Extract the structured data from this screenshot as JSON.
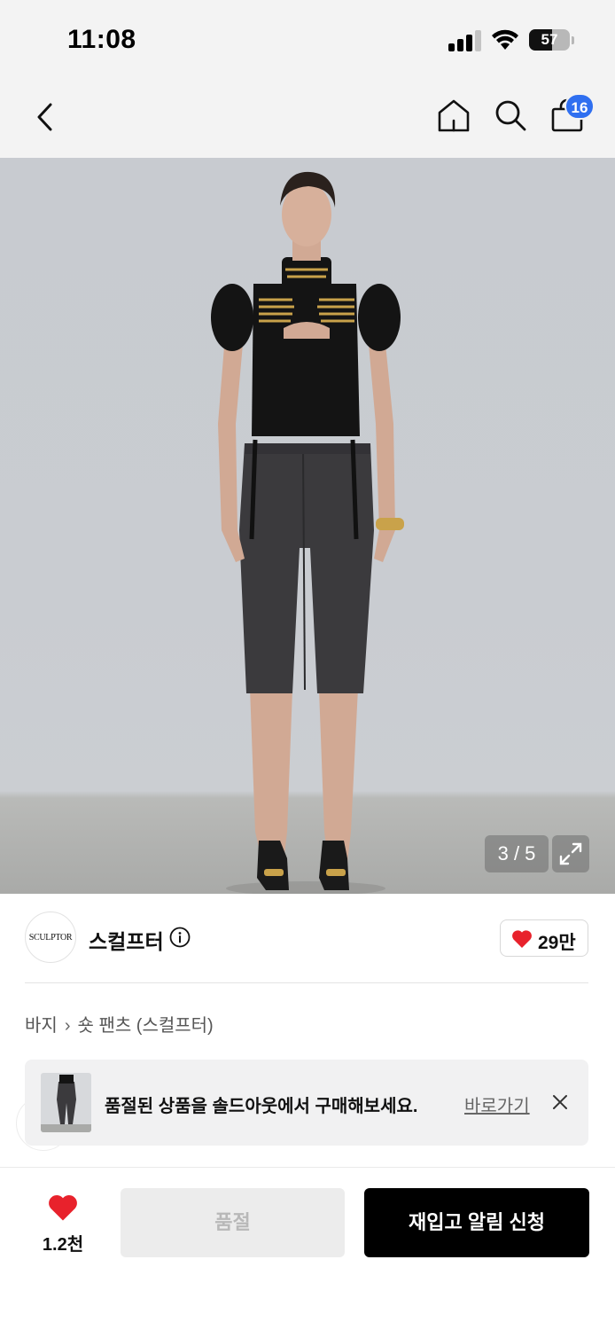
{
  "status_bar": {
    "time": "11:08",
    "battery_level": "57",
    "battery_fraction": 0.57,
    "signal_bars": 3
  },
  "nav": {
    "back_icon": "chevron-left-icon",
    "home_icon": "home-icon",
    "search_icon": "search-icon",
    "cart_icon": "shopping-bag-icon",
    "cart_count": "16",
    "badge_color": "#2f6ff0"
  },
  "product_image": {
    "counter": "3 / 5",
    "expand_icon": "expand-icon"
  },
  "brand": {
    "logo_text": "SCULPTOR",
    "name": "스컬프터",
    "info_icon": "info-icon",
    "likes": "29만",
    "heart_color": "#e8222c"
  },
  "breadcrumb": {
    "category": "바지",
    "subcategory": "숏 팬츠 (스컬프터)"
  },
  "toast": {
    "message": "품절된 상품을 솔드아웃에서 구매해보세요.",
    "link_label": "바로가기",
    "close_icon": "close-icon"
  },
  "bottom_bar": {
    "wish_count": "1.2천",
    "soldout_label": "품절",
    "restock_label": "재입고 알림 신청"
  }
}
